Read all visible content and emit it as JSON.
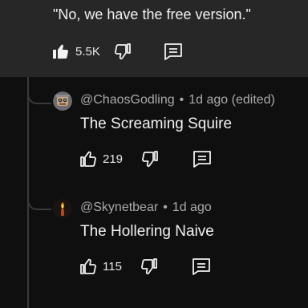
{
  "top_comment": {
    "text": "\"No, we have the free version.\"",
    "like_count": "5.5K"
  },
  "replies": [
    {
      "author": "@ChaosGodling",
      "time": "1d ago (edited)",
      "text": "The Screaming Squire",
      "like_count": "219",
      "avatar_icon": "robot-avatar"
    },
    {
      "author": "@Skynetbear",
      "time": "1d ago",
      "text": "The Hollering Naive",
      "like_count": "115",
      "avatar_icon": "candle-avatar"
    }
  ],
  "separator": "•",
  "colors": {
    "background": "#0f0f0f",
    "highlight": "#272727",
    "text": "#f1f1f1",
    "meta": "#aaaaaa",
    "thread_line": "#3a3a3a"
  }
}
